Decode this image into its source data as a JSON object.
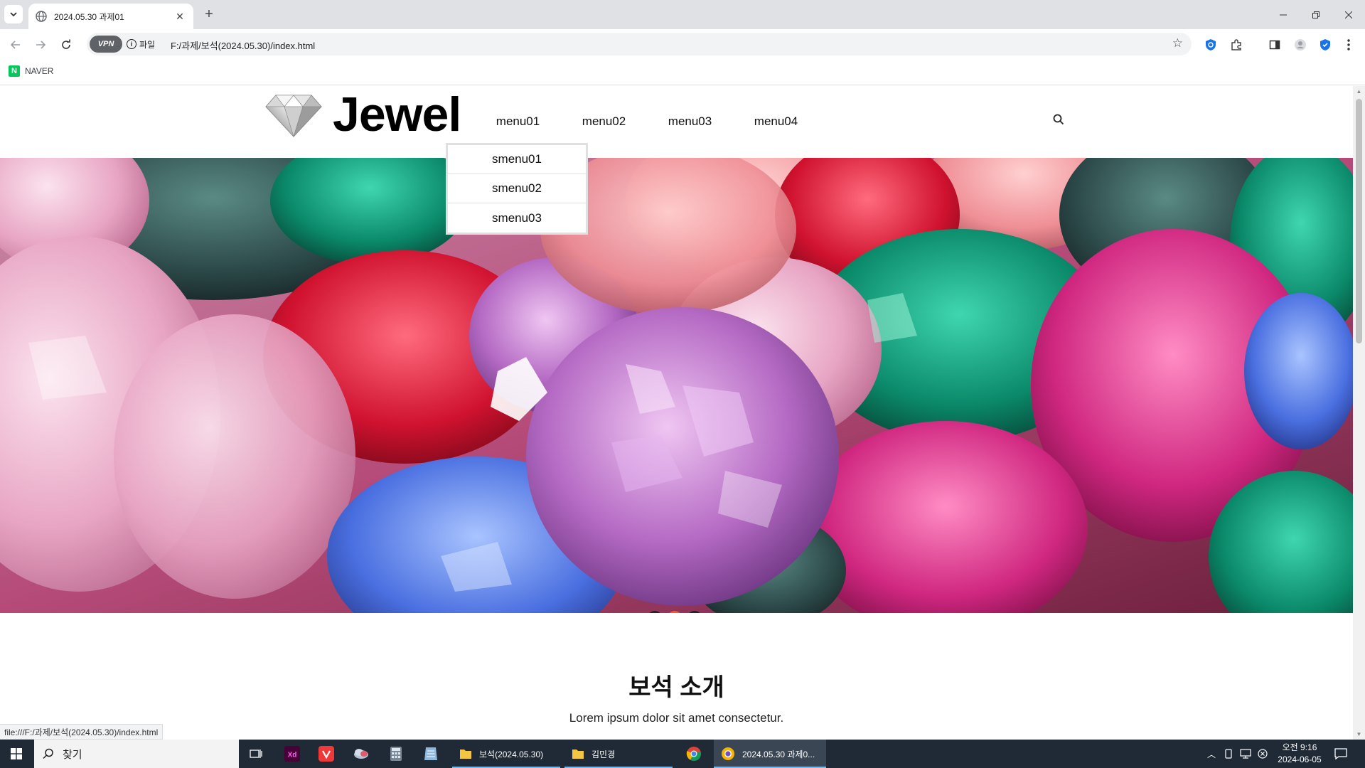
{
  "browser": {
    "tab_title": "2024.05.30 과제01",
    "address_chip": "파일",
    "vpn_label": "VPN",
    "url": "F:/과제/보석(2024.05.30)/index.html",
    "bookmarks": [
      {
        "label": "NAVER",
        "icon": "naver-icon"
      }
    ],
    "status_url": "file:///F:/과제/보석(2024.05.30)/index.html"
  },
  "site": {
    "logo_text": "Jewel",
    "logo_icon": "diamond-icon",
    "nav": [
      "menu01",
      "menu02",
      "menu03",
      "menu04"
    ],
    "submenu": [
      "smenu01",
      "smenu02",
      "smenu03"
    ],
    "search_icon": "search-icon",
    "slider": {
      "pages": [
        "1",
        "2",
        "3"
      ],
      "active_page": 2,
      "active_color": "#ff5533"
    },
    "intro": {
      "title": "보석 소개",
      "text": "Lorem ipsum dolor sit amet consectetur."
    }
  },
  "taskbar": {
    "search_placeholder": "찾기",
    "apps": [
      {
        "label": "보석(2024.05.30)",
        "icon": "folder-icon"
      },
      {
        "label": "김민경",
        "icon": "folder-icon"
      },
      {
        "label": "2024.05.30 과제0...",
        "icon": "browser-icon"
      }
    ],
    "pinned": [
      "task-view-icon",
      "xd-icon",
      "vivaldi-icon",
      "cloud-icon",
      "calculator-icon",
      "notepad-icon",
      "chrome-icon"
    ],
    "clock_time": "오전 9:16",
    "clock_date": "2024-06-05"
  }
}
